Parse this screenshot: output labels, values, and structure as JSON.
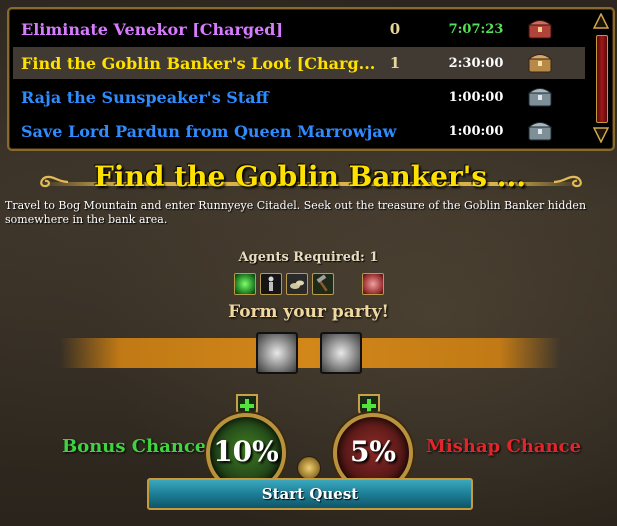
{
  "quests": [
    {
      "name": "Eliminate Venekor [Charged]",
      "count": "0",
      "time": "7:07:23",
      "name_color": "#d77bff",
      "time_color": "#55e255",
      "chest": "red-chest-icon"
    },
    {
      "name": "Find the Goblin Banker's Loot [Charg...",
      "count": "1",
      "time": "2:30:00",
      "name_color": "#ffe100",
      "time_color": "#ffffff",
      "chest": "gold-chest-icon"
    },
    {
      "name": "Raja the Sunspeaker's Staff",
      "count": "",
      "time": "1:00:00",
      "name_color": "#2f8cff",
      "time_color": "#ffffff",
      "chest": "blue-chest-icon"
    },
    {
      "name": "Save Lord Pardun from Queen Marrowjaw",
      "count": "",
      "time": "1:00:00",
      "name_color": "#2f8cff",
      "time_color": "#ffffff",
      "chest": "blue-chest-icon"
    }
  ],
  "selected_quest_index": 1,
  "detail": {
    "title": "Find the Goblin Banker's ...",
    "description": "Travel to Bog Mountain and enter Runnyeye Citadel. Seek out the treasure of the Goblin Banker hidden somewhere in the bank area.",
    "agents_required": "Agents Required: 1",
    "requirement_icons": [
      "green-orb-icon",
      "figure-icon",
      "coins-icon",
      "hammer-icon",
      "brain-icon"
    ],
    "form_party": "Form your party!",
    "bonus_label": "Bonus Chance",
    "bonus_value": "10%",
    "mishap_label": "Mishap Chance",
    "mishap_value": "5%",
    "start_button": "Start Quest"
  },
  "colors": {
    "bonus": "#3fd43f",
    "mishap": "#e0262b",
    "title": "#ffe100",
    "frame": "#8a6a2c"
  }
}
